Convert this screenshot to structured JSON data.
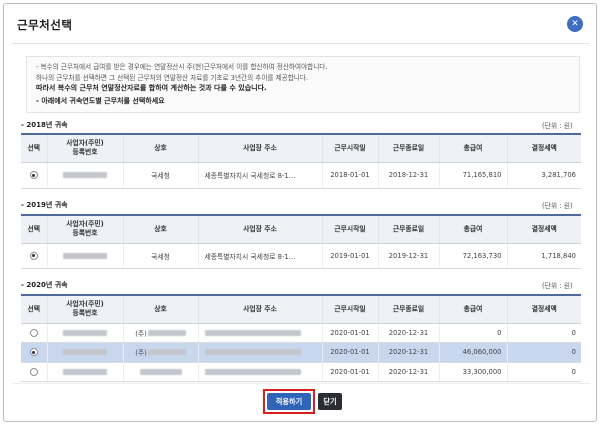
{
  "dialog": {
    "title": "근무처선택",
    "close_icon": "close-icon",
    "notice": {
      "line1": "- 복수의 근무처에서 급여를 받은 경우에는 연말정산시 주(현)근무처에서 이를 합산하여 정산하여야합니다.",
      "line2": "하나의 근무처를 선택하면 그 선택된 근무처의 연말정산 자료를 기초로 3년간의 추이를 제공합니다.",
      "line3": "따라서 복수의 근무처 연말정산자료를 합하여 계산하는 것과 다를 수 있습니다.",
      "line4": "- 아래에서 귀속연도별 근무처를 선택하세요"
    },
    "unit_label": "(단위 : 원)",
    "columns": {
      "select": "선택",
      "bizno_line1": "사업자(주민)",
      "bizno_line2": "등록번호",
      "name": "상호",
      "address": "사업장 주소",
      "start": "근무시작일",
      "end": "근무종료일",
      "total": "총급여",
      "tax": "결정세액"
    },
    "sections": [
      {
        "title": "- 2018년 귀속",
        "rows": [
          {
            "checked": true,
            "name": "국세청",
            "address": "세종특별자치시 국세청로 8-1…",
            "start": "2018-01-01",
            "end": "2018-12-31",
            "total": "71,165,810",
            "tax": "3,281,706"
          }
        ]
      },
      {
        "title": "- 2019년 귀속",
        "rows": [
          {
            "checked": true,
            "name": "국세청",
            "address": "세종특별자치시 국세청로 8-1…",
            "start": "2019-01-01",
            "end": "2019-12-31",
            "total": "72,163,730",
            "tax": "1,718,840"
          }
        ]
      },
      {
        "title": "- 2020년 귀속",
        "rows": [
          {
            "checked": false,
            "name_prefix": "(주)",
            "start": "2020-01-01",
            "end": "2020-12-31",
            "total": "0",
            "tax": "0"
          },
          {
            "checked": true,
            "name_prefix": "(주)",
            "start": "2020-01-01",
            "end": "2020-12-31",
            "total": "46,060,000",
            "tax": "0"
          },
          {
            "checked": false,
            "name_prefix": "",
            "start": "2020-01-01",
            "end": "2020-12-31",
            "total": "33,300,000",
            "tax": "0"
          }
        ]
      }
    ],
    "buttons": {
      "apply": "적용하기",
      "close": "닫기"
    }
  }
}
